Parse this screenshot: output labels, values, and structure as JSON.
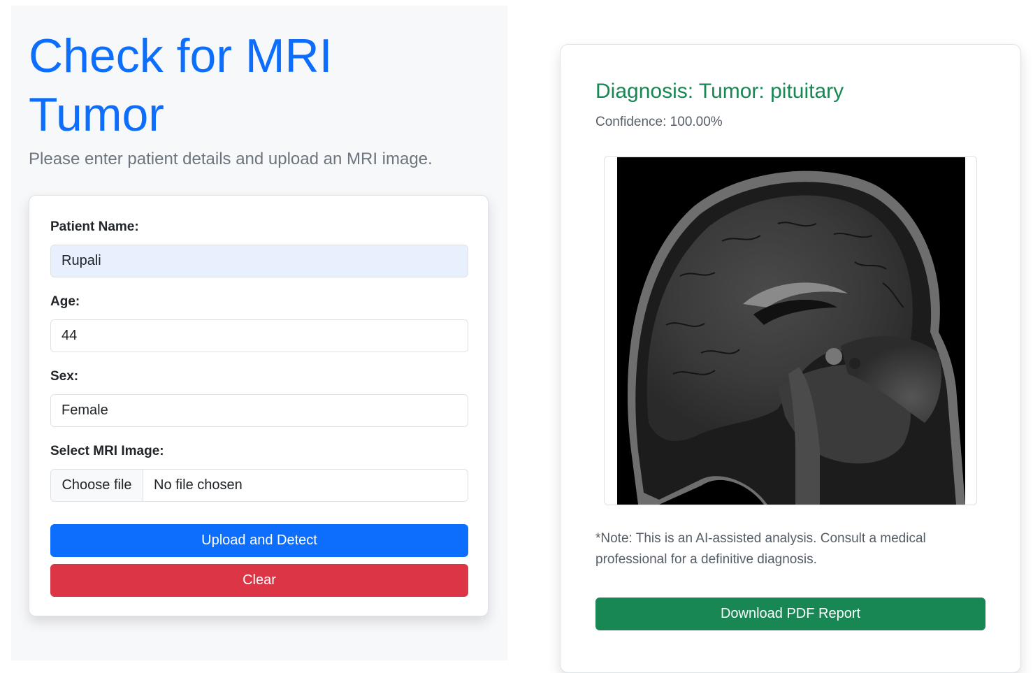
{
  "page": {
    "title": "Check for MRI Tumor",
    "subtitle": "Please enter patient details and upload an MRI image."
  },
  "form": {
    "name_label": "Patient Name:",
    "name_value": "Rupali",
    "age_label": "Age:",
    "age_value": "44",
    "sex_label": "Sex:",
    "sex_value": "Female",
    "image_label": "Select MRI Image:",
    "file_button": "Choose file",
    "file_status": "No file chosen",
    "upload_button": "Upload and Detect",
    "clear_button": "Clear"
  },
  "result": {
    "diagnosis": "Diagnosis: Tumor: pituitary",
    "confidence": "Confidence: 100.00%",
    "note": "*Note: This is an AI-assisted analysis. Consult a medical professional for a definitive diagnosis.",
    "download_button": "Download PDF Report"
  },
  "colors": {
    "primary": "#0d6efd",
    "danger": "#dc3545",
    "success": "#198754",
    "muted": "#6c757d"
  }
}
